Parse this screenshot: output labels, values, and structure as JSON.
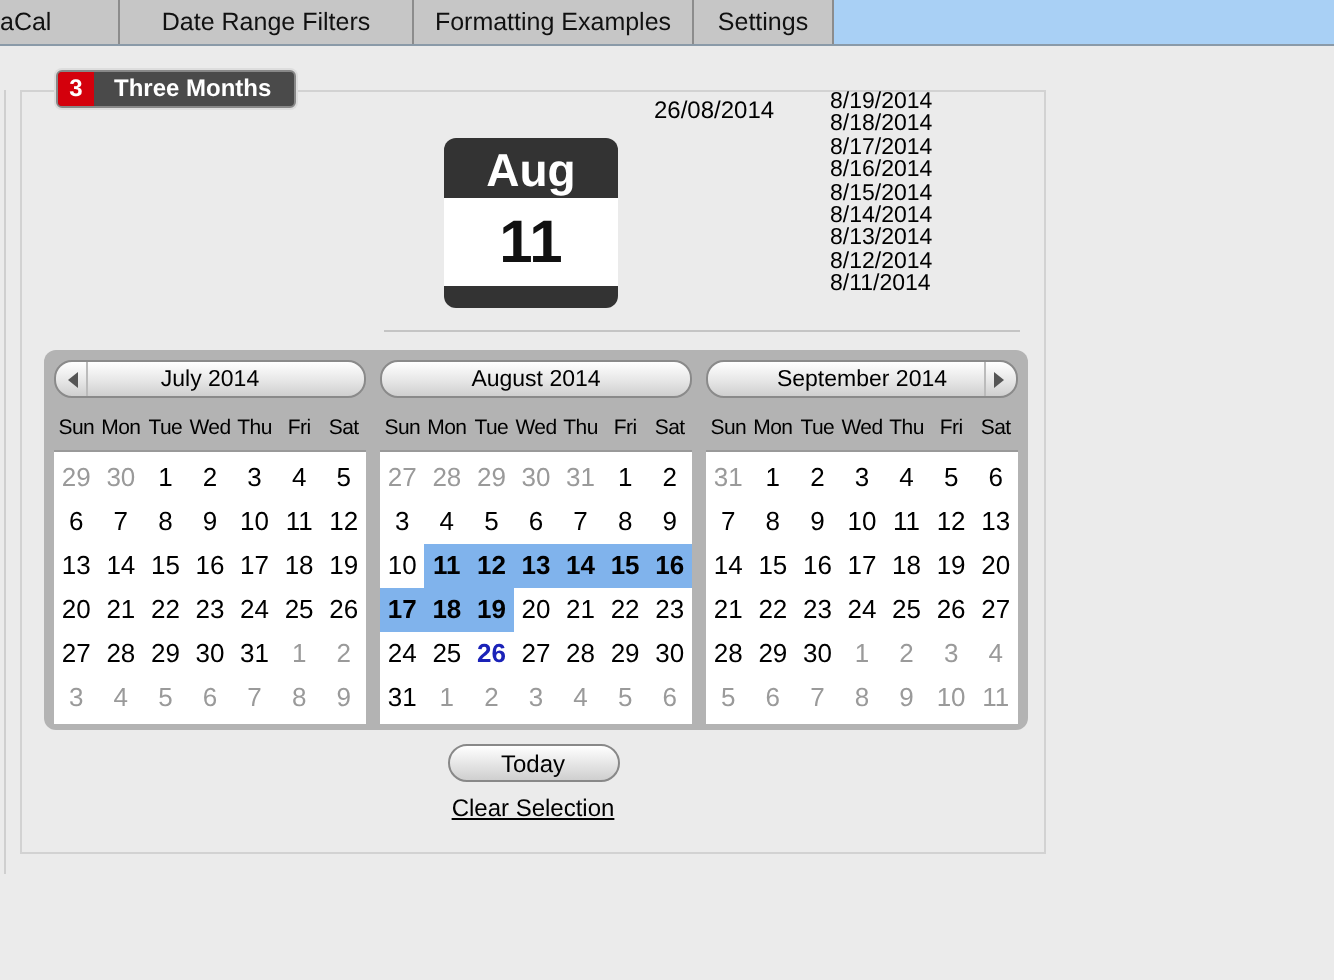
{
  "tabs": [
    {
      "label": "aCal",
      "selected": false
    },
    {
      "label": "Date Range Filters",
      "selected": false
    },
    {
      "label": "Formatting Examples",
      "selected": false
    },
    {
      "label": "Settings",
      "selected": false
    }
  ],
  "group": {
    "badge_number": "3",
    "title": "Three Months"
  },
  "date_icon": {
    "month": "Aug",
    "day": "11"
  },
  "current_date": "26/08/2014",
  "selected_dates": [
    "8/19/2014",
    "8/18/2014",
    "8/17/2014",
    "8/16/2014",
    "8/15/2014",
    "8/14/2014",
    "8/13/2014",
    "8/12/2014",
    "8/11/2014"
  ],
  "months": [
    {
      "title": "July 2014",
      "prev_arrow": true,
      "weekdays": [
        "Sun",
        "Mon",
        "Tue",
        "Wed",
        "Thu",
        "Fri",
        "Sat"
      ],
      "weeks": [
        [
          {
            "day": "29",
            "muted": true,
            "selected": false,
            "today": false
          },
          {
            "day": "30",
            "muted": true,
            "selected": false,
            "today": false
          },
          {
            "day": "1",
            "muted": false,
            "selected": false,
            "today": false
          },
          {
            "day": "2",
            "muted": false,
            "selected": false,
            "today": false
          },
          {
            "day": "3",
            "muted": false,
            "selected": false,
            "today": false
          },
          {
            "day": "4",
            "muted": false,
            "selected": false,
            "today": false
          },
          {
            "day": "5",
            "muted": false,
            "selected": false,
            "today": false
          }
        ],
        [
          {
            "day": "6",
            "muted": false,
            "selected": false,
            "today": false
          },
          {
            "day": "7",
            "muted": false,
            "selected": false,
            "today": false
          },
          {
            "day": "8",
            "muted": false,
            "selected": false,
            "today": false
          },
          {
            "day": "9",
            "muted": false,
            "selected": false,
            "today": false
          },
          {
            "day": "10",
            "muted": false,
            "selected": false,
            "today": false
          },
          {
            "day": "11",
            "muted": false,
            "selected": false,
            "today": false
          },
          {
            "day": "12",
            "muted": false,
            "selected": false,
            "today": false
          }
        ],
        [
          {
            "day": "13",
            "muted": false,
            "selected": false,
            "today": false
          },
          {
            "day": "14",
            "muted": false,
            "selected": false,
            "today": false
          },
          {
            "day": "15",
            "muted": false,
            "selected": false,
            "today": false
          },
          {
            "day": "16",
            "muted": false,
            "selected": false,
            "today": false
          },
          {
            "day": "17",
            "muted": false,
            "selected": false,
            "today": false
          },
          {
            "day": "18",
            "muted": false,
            "selected": false,
            "today": false
          },
          {
            "day": "19",
            "muted": false,
            "selected": false,
            "today": false
          }
        ],
        [
          {
            "day": "20",
            "muted": false,
            "selected": false,
            "today": false
          },
          {
            "day": "21",
            "muted": false,
            "selected": false,
            "today": false
          },
          {
            "day": "22",
            "muted": false,
            "selected": false,
            "today": false
          },
          {
            "day": "23",
            "muted": false,
            "selected": false,
            "today": false
          },
          {
            "day": "24",
            "muted": false,
            "selected": false,
            "today": false
          },
          {
            "day": "25",
            "muted": false,
            "selected": false,
            "today": false
          },
          {
            "day": "26",
            "muted": false,
            "selected": false,
            "today": false
          }
        ],
        [
          {
            "day": "27",
            "muted": false,
            "selected": false,
            "today": false
          },
          {
            "day": "28",
            "muted": false,
            "selected": false,
            "today": false
          },
          {
            "day": "29",
            "muted": false,
            "selected": false,
            "today": false
          },
          {
            "day": "30",
            "muted": false,
            "selected": false,
            "today": false
          },
          {
            "day": "31",
            "muted": false,
            "selected": false,
            "today": false
          },
          {
            "day": "1",
            "muted": true,
            "selected": false,
            "today": false
          },
          {
            "day": "2",
            "muted": true,
            "selected": false,
            "today": false
          }
        ],
        [
          {
            "day": "3",
            "muted": true,
            "selected": false,
            "today": false
          },
          {
            "day": "4",
            "muted": true,
            "selected": false,
            "today": false
          },
          {
            "day": "5",
            "muted": true,
            "selected": false,
            "today": false
          },
          {
            "day": "6",
            "muted": true,
            "selected": false,
            "today": false
          },
          {
            "day": "7",
            "muted": true,
            "selected": false,
            "today": false
          },
          {
            "day": "8",
            "muted": true,
            "selected": false,
            "today": false
          },
          {
            "day": "9",
            "muted": true,
            "selected": false,
            "today": false
          }
        ]
      ]
    },
    {
      "title": "August 2014",
      "weekdays": [
        "Sun",
        "Mon",
        "Tue",
        "Wed",
        "Thu",
        "Fri",
        "Sat"
      ],
      "weeks": [
        [
          {
            "day": "27",
            "muted": true,
            "selected": false,
            "today": false
          },
          {
            "day": "28",
            "muted": true,
            "selected": false,
            "today": false
          },
          {
            "day": "29",
            "muted": true,
            "selected": false,
            "today": false
          },
          {
            "day": "30",
            "muted": true,
            "selected": false,
            "today": false
          },
          {
            "day": "31",
            "muted": true,
            "selected": false,
            "today": false
          },
          {
            "day": "1",
            "muted": false,
            "selected": false,
            "today": false
          },
          {
            "day": "2",
            "muted": false,
            "selected": false,
            "today": false
          }
        ],
        [
          {
            "day": "3",
            "muted": false,
            "selected": false,
            "today": false
          },
          {
            "day": "4",
            "muted": false,
            "selected": false,
            "today": false
          },
          {
            "day": "5",
            "muted": false,
            "selected": false,
            "today": false
          },
          {
            "day": "6",
            "muted": false,
            "selected": false,
            "today": false
          },
          {
            "day": "7",
            "muted": false,
            "selected": false,
            "today": false
          },
          {
            "day": "8",
            "muted": false,
            "selected": false,
            "today": false
          },
          {
            "day": "9",
            "muted": false,
            "selected": false,
            "today": false
          }
        ],
        [
          {
            "day": "10",
            "muted": false,
            "selected": false,
            "today": false
          },
          {
            "day": "11",
            "muted": false,
            "selected": true,
            "today": false
          },
          {
            "day": "12",
            "muted": false,
            "selected": true,
            "today": false
          },
          {
            "day": "13",
            "muted": false,
            "selected": true,
            "today": false
          },
          {
            "day": "14",
            "muted": false,
            "selected": true,
            "today": false
          },
          {
            "day": "15",
            "muted": false,
            "selected": true,
            "today": false
          },
          {
            "day": "16",
            "muted": false,
            "selected": true,
            "today": false
          }
        ],
        [
          {
            "day": "17",
            "muted": false,
            "selected": true,
            "today": false
          },
          {
            "day": "18",
            "muted": false,
            "selected": true,
            "today": false
          },
          {
            "day": "19",
            "muted": false,
            "selected": true,
            "today": false
          },
          {
            "day": "20",
            "muted": false,
            "selected": false,
            "today": false
          },
          {
            "day": "21",
            "muted": false,
            "selected": false,
            "today": false
          },
          {
            "day": "22",
            "muted": false,
            "selected": false,
            "today": false
          },
          {
            "day": "23",
            "muted": false,
            "selected": false,
            "today": false
          }
        ],
        [
          {
            "day": "24",
            "muted": false,
            "selected": false,
            "today": false
          },
          {
            "day": "25",
            "muted": false,
            "selected": false,
            "today": false
          },
          {
            "day": "26",
            "muted": false,
            "selected": false,
            "today": true
          },
          {
            "day": "27",
            "muted": false,
            "selected": false,
            "today": false
          },
          {
            "day": "28",
            "muted": false,
            "selected": false,
            "today": false
          },
          {
            "day": "29",
            "muted": false,
            "selected": false,
            "today": false
          },
          {
            "day": "30",
            "muted": false,
            "selected": false,
            "today": false
          }
        ],
        [
          {
            "day": "31",
            "muted": false,
            "selected": false,
            "today": false
          },
          {
            "day": "1",
            "muted": true,
            "selected": false,
            "today": false
          },
          {
            "day": "2",
            "muted": true,
            "selected": false,
            "today": false
          },
          {
            "day": "3",
            "muted": true,
            "selected": false,
            "today": false
          },
          {
            "day": "4",
            "muted": true,
            "selected": false,
            "today": false
          },
          {
            "day": "5",
            "muted": true,
            "selected": false,
            "today": false
          },
          {
            "day": "6",
            "muted": true,
            "selected": false,
            "today": false
          }
        ]
      ]
    },
    {
      "title": "September 2014",
      "next_arrow": true,
      "weekdays": [
        "Sun",
        "Mon",
        "Tue",
        "Wed",
        "Thu",
        "Fri",
        "Sat"
      ],
      "weeks": [
        [
          {
            "day": "31",
            "muted": true,
            "selected": false,
            "today": false
          },
          {
            "day": "1",
            "muted": false,
            "selected": false,
            "today": false
          },
          {
            "day": "2",
            "muted": false,
            "selected": false,
            "today": false
          },
          {
            "day": "3",
            "muted": false,
            "selected": false,
            "today": false
          },
          {
            "day": "4",
            "muted": false,
            "selected": false,
            "today": false
          },
          {
            "day": "5",
            "muted": false,
            "selected": false,
            "today": false
          },
          {
            "day": "6",
            "muted": false,
            "selected": false,
            "today": false
          }
        ],
        [
          {
            "day": "7",
            "muted": false,
            "selected": false,
            "today": false
          },
          {
            "day": "8",
            "muted": false,
            "selected": false,
            "today": false
          },
          {
            "day": "9",
            "muted": false,
            "selected": false,
            "today": false
          },
          {
            "day": "10",
            "muted": false,
            "selected": false,
            "today": false
          },
          {
            "day": "11",
            "muted": false,
            "selected": false,
            "today": false
          },
          {
            "day": "12",
            "muted": false,
            "selected": false,
            "today": false
          },
          {
            "day": "13",
            "muted": false,
            "selected": false,
            "today": false
          }
        ],
        [
          {
            "day": "14",
            "muted": false,
            "selected": false,
            "today": false
          },
          {
            "day": "15",
            "muted": false,
            "selected": false,
            "today": false
          },
          {
            "day": "16",
            "muted": false,
            "selected": false,
            "today": false
          },
          {
            "day": "17",
            "muted": false,
            "selected": false,
            "today": false
          },
          {
            "day": "18",
            "muted": false,
            "selected": false,
            "today": false
          },
          {
            "day": "19",
            "muted": false,
            "selected": false,
            "today": false
          },
          {
            "day": "20",
            "muted": false,
            "selected": false,
            "today": false
          }
        ],
        [
          {
            "day": "21",
            "muted": false,
            "selected": false,
            "today": false
          },
          {
            "day": "22",
            "muted": false,
            "selected": false,
            "today": false
          },
          {
            "day": "23",
            "muted": false,
            "selected": false,
            "today": false
          },
          {
            "day": "24",
            "muted": false,
            "selected": false,
            "today": false
          },
          {
            "day": "25",
            "muted": false,
            "selected": false,
            "today": false
          },
          {
            "day": "26",
            "muted": false,
            "selected": false,
            "today": false
          },
          {
            "day": "27",
            "muted": false,
            "selected": false,
            "today": false
          }
        ],
        [
          {
            "day": "28",
            "muted": false,
            "selected": false,
            "today": false
          },
          {
            "day": "29",
            "muted": false,
            "selected": false,
            "today": false
          },
          {
            "day": "30",
            "muted": false,
            "selected": false,
            "today": false
          },
          {
            "day": "1",
            "muted": true,
            "selected": false,
            "today": false
          },
          {
            "day": "2",
            "muted": true,
            "selected": false,
            "today": false
          },
          {
            "day": "3",
            "muted": true,
            "selected": false,
            "today": false
          },
          {
            "day": "4",
            "muted": true,
            "selected": false,
            "today": false
          }
        ],
        [
          {
            "day": "5",
            "muted": true,
            "selected": false,
            "today": false
          },
          {
            "day": "6",
            "muted": true,
            "selected": false,
            "today": false
          },
          {
            "day": "7",
            "muted": true,
            "selected": false,
            "today": false
          },
          {
            "day": "8",
            "muted": true,
            "selected": false,
            "today": false
          },
          {
            "day": "9",
            "muted": true,
            "selected": false,
            "today": false
          },
          {
            "day": "10",
            "muted": true,
            "selected": false,
            "today": false
          },
          {
            "day": "11",
            "muted": true,
            "selected": false,
            "today": false
          }
        ]
      ]
    }
  ],
  "today_button": "Today",
  "clear_link": "Clear Selection"
}
